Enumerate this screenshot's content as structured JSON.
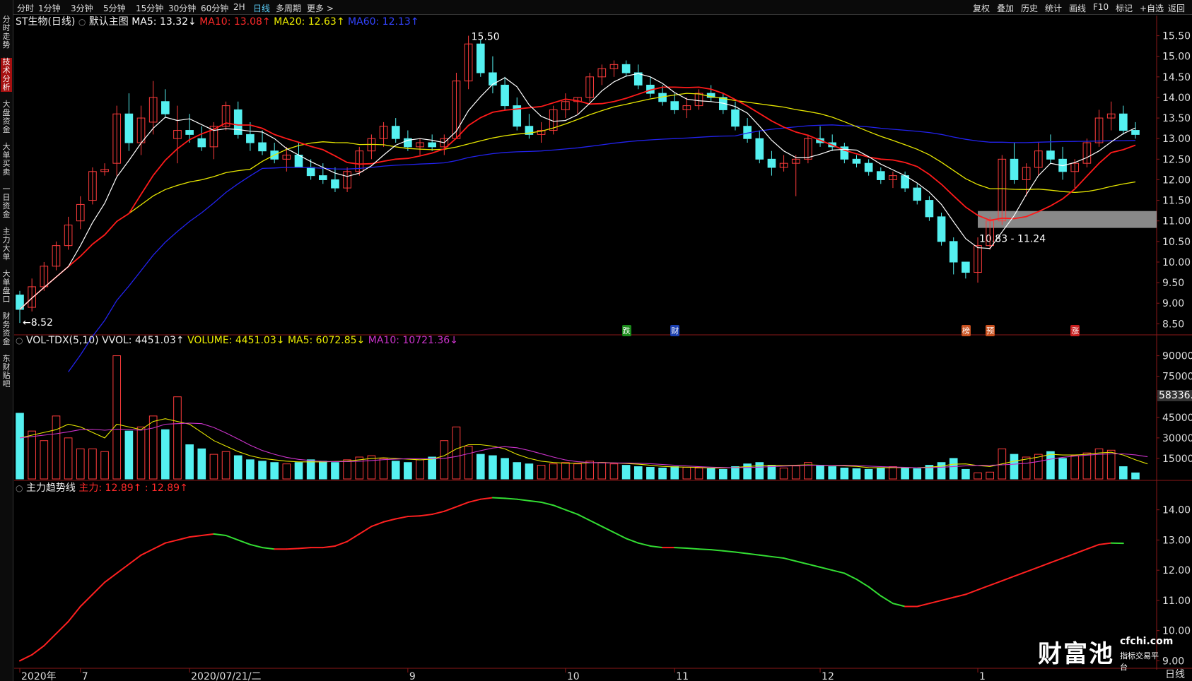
{
  "toolbar": {
    "left_items": [
      "分时",
      "1分钟",
      "3分钟",
      "5分钟",
      "15分钟",
      "30分钟",
      "60分钟",
      "2H",
      "日线",
      "多周期",
      "更多 >"
    ],
    "active_index": 8,
    "right_items": [
      "复权",
      "叠加",
      "历史",
      "统计",
      "画线",
      "F10",
      "标记",
      "+自选",
      "返回"
    ]
  },
  "side_tabs": [
    {
      "label": "分时走势",
      "active": false
    },
    {
      "label": "技术分析",
      "active": true
    },
    {
      "label": "大盘资金",
      "active": false
    },
    {
      "label": "大单买卖",
      "active": false
    },
    {
      "label": "一日资金",
      "active": false
    },
    {
      "label": "主力大单",
      "active": false
    },
    {
      "label": "大单盘口",
      "active": false
    },
    {
      "label": "财务资金",
      "active": false
    },
    {
      "label": "东财贴吧",
      "active": false
    }
  ],
  "main_legend": {
    "title": "ST生物(日线)",
    "template": "默认主图",
    "ma5": "MA5: 13.32↓",
    "ma10": "MA10: 13.08↑",
    "ma20": "MA20: 12.63↑",
    "ma60": "MA60: 12.13↑"
  },
  "vol_legend": {
    "name": "VOL-TDX(5,10) VVOL: 4451.03↑",
    "volume": "VOLUME: 4451.03↓",
    "ma5": "MA5: 6072.85↓",
    "ma10": "MA10: 10721.36↓"
  },
  "trend_legend": {
    "name": "主力趋势线",
    "value1": "主力: 12.89↑",
    "value2": ": 12.89↑"
  },
  "annotations": {
    "high": "15.50",
    "low": "←8.52",
    "zone": "10.83 - 11.24",
    "volume_marker": "58336.",
    "bottom_right": "日线",
    "logo_main": "财富池",
    "logo_domain": "cfchi.com",
    "logo_sub": "指标交易平台"
  },
  "event_flags": [
    {
      "label": "跌",
      "color": "#1a8a1a",
      "x_index": 50
    },
    {
      "label": "财",
      "color": "#1a3fb0",
      "x_index": 54
    },
    {
      "label": "榜",
      "color": "#c8501e",
      "x_index": 78
    },
    {
      "label": "预",
      "color": "#c8501e",
      "x_index": 80
    },
    {
      "label": "涨",
      "color": "#c81e1e",
      "x_index": 87
    }
  ],
  "colors": {
    "up": "#ff3c3c",
    "down": "#54f0f0",
    "ma5": "#ffffff",
    "ma10": "#ff1a1a",
    "ma20": "#e6e600",
    "ma60": "#2222ee",
    "vol_ma5": "#e6e600",
    "vol_ma10": "#cc33cc",
    "trend_up": "#ff2020",
    "trend_down": "#33dd33"
  },
  "chart_data": [
    {
      "type": "candlestick",
      "title": "ST生物(日线)",
      "y_ticks": [
        15.5,
        15.0,
        14.5,
        14.0,
        13.5,
        13.0,
        12.5,
        12.0,
        11.5,
        11.0,
        10.5,
        10.0,
        9.5,
        9.0,
        8.5
      ],
      "y_range": [
        8.3,
        15.75
      ],
      "x_labels": [
        {
          "label": "2020年",
          "index": 0
        },
        {
          "label": "7",
          "index": 5
        },
        {
          "label": "2020/07/21/二",
          "index": 14
        },
        {
          "label": "9",
          "index": 32
        },
        {
          "label": "10",
          "index": 45
        },
        {
          "label": "11",
          "index": 54
        },
        {
          "label": "12",
          "index": 66
        },
        {
          "label": "1",
          "index": 79
        }
      ],
      "ohlc": [
        [
          9.2,
          9.3,
          8.52,
          8.85
        ],
        [
          8.9,
          9.6,
          8.8,
          9.4
        ],
        [
          9.4,
          10.0,
          9.3,
          9.9
        ],
        [
          9.9,
          10.5,
          9.8,
          10.4
        ],
        [
          10.4,
          11.1,
          10.3,
          10.9
        ],
        [
          11.0,
          11.6,
          10.8,
          11.4
        ],
        [
          11.5,
          12.3,
          11.4,
          12.2
        ],
        [
          12.2,
          12.4,
          12.1,
          12.25
        ],
        [
          12.4,
          13.8,
          12.1,
          13.6
        ],
        [
          13.6,
          14.1,
          12.7,
          12.9
        ],
        [
          12.9,
          13.8,
          12.6,
          13.5
        ],
        [
          13.4,
          14.4,
          13.1,
          14.0
        ],
        [
          13.9,
          14.2,
          13.5,
          13.6
        ],
        [
          13.0,
          13.8,
          12.4,
          13.2
        ],
        [
          13.2,
          13.6,
          12.9,
          13.1
        ],
        [
          13.0,
          13.3,
          12.7,
          12.8
        ],
        [
          12.8,
          13.4,
          12.5,
          13.3
        ],
        [
          13.3,
          13.9,
          13.2,
          13.8
        ],
        [
          13.7,
          13.9,
          13.0,
          13.1
        ],
        [
          13.1,
          13.4,
          12.7,
          12.9
        ],
        [
          12.9,
          13.2,
          12.6,
          12.7
        ],
        [
          12.7,
          12.9,
          12.4,
          12.5
        ],
        [
          12.5,
          12.8,
          12.2,
          12.6
        ],
        [
          12.6,
          12.9,
          12.4,
          12.3
        ],
        [
          12.3,
          12.5,
          12.0,
          12.1
        ],
        [
          12.1,
          12.4,
          11.9,
          12.0
        ],
        [
          12.0,
          12.3,
          11.7,
          11.8
        ],
        [
          11.8,
          12.3,
          11.7,
          12.2
        ],
        [
          12.2,
          12.8,
          12.1,
          12.7
        ],
        [
          12.7,
          13.1,
          12.5,
          13.0
        ],
        [
          13.0,
          13.4,
          12.8,
          13.3
        ],
        [
          13.3,
          13.5,
          12.9,
          13.0
        ],
        [
          13.0,
          13.2,
          12.7,
          12.8
        ],
        [
          12.8,
          13.0,
          12.6,
          12.9
        ],
        [
          12.9,
          13.1,
          12.7,
          12.8
        ],
        [
          12.8,
          13.1,
          12.6,
          13.0
        ],
        [
          13.0,
          14.6,
          13.0,
          14.4
        ],
        [
          14.4,
          15.5,
          14.2,
          15.3
        ],
        [
          15.3,
          15.4,
          14.5,
          14.6
        ],
        [
          14.6,
          15.0,
          14.1,
          14.3
        ],
        [
          14.3,
          14.5,
          13.7,
          13.8
        ],
        [
          13.8,
          14.0,
          13.2,
          13.3
        ],
        [
          13.3,
          13.6,
          13.0,
          13.1
        ],
        [
          13.1,
          13.4,
          12.9,
          13.2
        ],
        [
          13.2,
          13.8,
          13.1,
          13.7
        ],
        [
          13.7,
          14.1,
          13.5,
          13.9
        ],
        [
          13.9,
          14.0,
          13.6,
          14.0
        ],
        [
          14.0,
          14.6,
          13.9,
          14.5
        ],
        [
          14.5,
          14.8,
          14.3,
          14.7
        ],
        [
          14.7,
          14.9,
          14.5,
          14.8
        ],
        [
          14.8,
          14.9,
          14.5,
          14.6
        ],
        [
          14.6,
          14.8,
          14.2,
          14.3
        ],
        [
          14.3,
          14.5,
          14.0,
          14.1
        ],
        [
          14.1,
          14.3,
          13.8,
          13.9
        ],
        [
          13.9,
          14.1,
          13.6,
          13.7
        ],
        [
          13.7,
          14.0,
          13.5,
          13.8
        ],
        [
          13.8,
          14.2,
          13.7,
          14.1
        ],
        [
          14.1,
          14.3,
          13.9,
          14.0
        ],
        [
          14.0,
          14.1,
          13.6,
          13.7
        ],
        [
          13.7,
          13.9,
          13.2,
          13.3
        ],
        [
          13.3,
          13.5,
          12.9,
          13.0
        ],
        [
          13.0,
          13.2,
          12.4,
          12.5
        ],
        [
          12.5,
          12.7,
          12.1,
          12.3
        ],
        [
          12.3,
          12.6,
          12.2,
          12.4
        ],
        [
          12.4,
          12.6,
          11.6,
          12.5
        ],
        [
          12.5,
          13.1,
          12.4,
          13.0
        ],
        [
          13.0,
          13.3,
          12.8,
          12.9
        ],
        [
          12.9,
          13.1,
          12.7,
          12.8
        ],
        [
          12.8,
          12.9,
          12.4,
          12.5
        ],
        [
          12.5,
          12.6,
          12.3,
          12.4
        ],
        [
          12.4,
          12.5,
          12.1,
          12.2
        ],
        [
          12.2,
          12.3,
          11.9,
          12.0
        ],
        [
          12.0,
          12.2,
          11.8,
          12.1
        ],
        [
          12.1,
          12.2,
          11.7,
          11.8
        ],
        [
          11.8,
          11.9,
          11.4,
          11.5
        ],
        [
          11.5,
          11.6,
          11.0,
          11.1
        ],
        [
          11.1,
          11.2,
          10.4,
          10.5
        ],
        [
          10.5,
          10.6,
          9.7,
          10.0
        ],
        [
          10.0,
          10.0,
          9.6,
          9.75
        ],
        [
          9.75,
          10.6,
          9.5,
          10.4
        ],
        [
          10.4,
          11.1,
          10.3,
          11.0
        ],
        [
          11.0,
          12.6,
          10.9,
          12.5
        ],
        [
          12.5,
          12.9,
          11.9,
          12.0
        ],
        [
          12.0,
          12.4,
          11.6,
          12.3
        ],
        [
          12.3,
          12.9,
          12.1,
          12.7
        ],
        [
          12.7,
          13.1,
          12.4,
          12.5
        ],
        [
          12.5,
          12.8,
          12.0,
          12.2
        ],
        [
          12.2,
          12.5,
          11.8,
          12.4
        ],
        [
          12.4,
          13.0,
          12.3,
          12.9
        ],
        [
          12.9,
          13.7,
          12.8,
          13.5
        ],
        [
          13.5,
          13.9,
          13.2,
          13.6
        ],
        [
          13.6,
          13.8,
          13.1,
          13.2
        ],
        [
          13.2,
          13.4,
          13.0,
          13.1
        ]
      ]
    },
    {
      "type": "bar",
      "title": "VOL-TDX(5,10)",
      "y_ticks": [
        90000,
        75000,
        60000,
        45000,
        30000,
        15000
      ],
      "y_range": [
        0,
        97000
      ],
      "values": [
        48000,
        35000,
        28000,
        46000,
        30000,
        22000,
        22000,
        20000,
        90000,
        35000,
        38000,
        46000,
        36000,
        60000,
        25000,
        22000,
        18000,
        20000,
        17000,
        14000,
        13000,
        12000,
        11000,
        12000,
        14000,
        13000,
        12000,
        14000,
        16000,
        17000,
        15000,
        13000,
        12000,
        14000,
        16000,
        28000,
        38000,
        24000,
        18000,
        17000,
        15000,
        12000,
        11000,
        10000,
        11000,
        12000,
        11000,
        13000,
        12000,
        11000,
        10000,
        9000,
        8500,
        8000,
        9000,
        8500,
        8000,
        7500,
        7000,
        9000,
        11000,
        12000,
        10000,
        8000,
        9500,
        12000,
        10000,
        9000,
        8000,
        7500,
        7000,
        8000,
        9000,
        8000,
        7500,
        10000,
        12000,
        15000,
        7000,
        4500,
        5000,
        22000,
        18000,
        16000,
        18000,
        20000,
        15000,
        17000,
        19000,
        22000,
        21000,
        9000,
        4451
      ],
      "ma5": [
        30000,
        32000,
        34000,
        36000,
        40000,
        38000,
        34000,
        30000,
        40000,
        38000,
        36000,
        42000,
        44000,
        42000,
        40000,
        34000,
        28000,
        24000,
        20000,
        17000,
        15000,
        14000,
        13000,
        12500,
        12500,
        12500,
        12800,
        13000,
        14000,
        15000,
        15500,
        15000,
        14500,
        14000,
        14500,
        17000,
        22000,
        25000,
        25000,
        24000,
        22000,
        18000,
        15000,
        13000,
        12000,
        11500,
        11500,
        11800,
        12000,
        11700,
        11300,
        10800,
        10000,
        9200,
        8800,
        8600,
        8400,
        8000,
        8000,
        8400,
        9100,
        9700,
        10000,
        9800,
        10000,
        10300,
        10000,
        9800,
        9600,
        9200,
        8300,
        8200,
        8300,
        8200,
        8300,
        8600,
        9400,
        10800,
        11000,
        9800,
        9100,
        11000,
        13000,
        14500,
        16000,
        18000,
        17500,
        17500,
        18000,
        19000,
        19500,
        17500,
        14000,
        11000
      ]
    },
    {
      "type": "line",
      "title": "主力趋势线",
      "y_ticks": [
        14.0,
        13.0,
        12.0,
        11.0,
        10.0,
        9.0
      ],
      "y_range": [
        8.8,
        14.6
      ],
      "values": [
        9.0,
        9.2,
        9.5,
        9.9,
        10.3,
        10.8,
        11.2,
        11.6,
        11.9,
        12.2,
        12.5,
        12.7,
        12.9,
        13.0,
        13.1,
        13.15,
        13.2,
        13.15,
        13.0,
        12.85,
        12.75,
        12.7,
        12.7,
        12.72,
        12.75,
        12.75,
        12.8,
        12.95,
        13.2,
        13.45,
        13.6,
        13.7,
        13.78,
        13.8,
        13.85,
        13.95,
        14.1,
        14.25,
        14.35,
        14.4,
        14.38,
        14.35,
        14.3,
        14.25,
        14.15,
        14.0,
        13.85,
        13.65,
        13.45,
        13.25,
        13.05,
        12.9,
        12.8,
        12.75,
        12.75,
        12.73,
        12.7,
        12.68,
        12.64,
        12.6,
        12.55,
        12.5,
        12.45,
        12.4,
        12.3,
        12.2,
        12.1,
        12.0,
        11.9,
        11.7,
        11.45,
        11.15,
        10.9,
        10.8,
        10.8,
        10.9,
        11.0,
        11.1,
        11.2,
        11.35,
        11.5,
        11.65,
        11.8,
        11.95,
        12.1,
        12.25,
        12.4,
        12.55,
        12.7,
        12.85,
        12.9,
        12.89
      ]
    }
  ]
}
